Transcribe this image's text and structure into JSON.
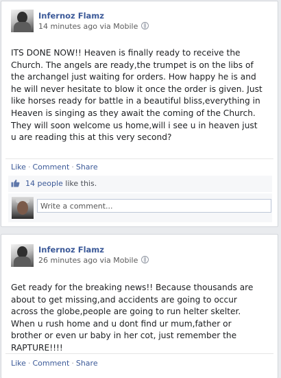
{
  "posts": [
    {
      "author": "Infernoz Flamz",
      "meta": "14 minutes ago via Mobile",
      "text": "ITS DONE NOW!! Heaven is finally ready to receive the Church. The angels are ready,the trumpet is on the libs of the archangel just waiting for orders. How happy he is and he will never hesitate to blow it once the order is given. Just like horses ready for battle in a beautiful bliss,everything in Heaven is singing as they await the coming of the Church. They will soon welcome us home,will i see u in heaven just u are reading this at this very second?",
      "actions": {
        "like": "Like",
        "comment": "Comment",
        "share": "Share"
      },
      "likes": {
        "people": "14 people",
        "suffix": "like this."
      },
      "comment_placeholder": "Write a comment..."
    },
    {
      "author": "Infernoz Flamz",
      "meta": "26 minutes ago via Mobile",
      "text": "Get ready for the breaking news!! Because thousands are about to get missing,and accidents are going to occur across the globe,people are going to run helter skelter. When u rush home and u dont find ur mum,father or brother or even ur baby in her cot, just remember the RAPTURE!!!!",
      "actions": {
        "like": "Like",
        "comment": "Comment",
        "share": "Share"
      }
    }
  ],
  "icons": {
    "privacy": "globe-icon",
    "like_count": "thumbs-up-icon"
  },
  "colors": {
    "link": "#3b5998",
    "background": "#e9ebee"
  }
}
